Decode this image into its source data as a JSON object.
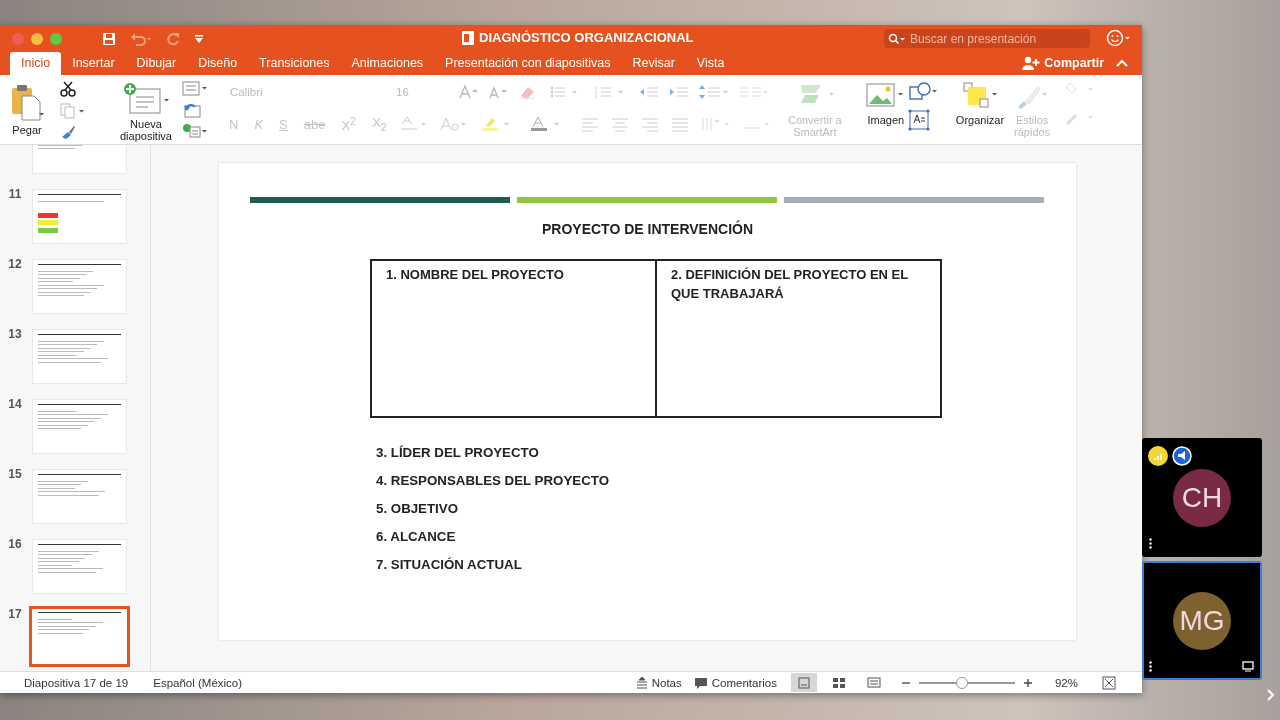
{
  "window": {
    "title": "DIAGNÓSTICO ORGANIZACIONAL",
    "search": {
      "placeholder": "Buscar en presentación"
    }
  },
  "ribbon_tabs": [
    {
      "label": "Inicio",
      "selected": true
    },
    {
      "label": "Insertar",
      "selected": false
    },
    {
      "label": "Dibujar",
      "selected": false
    },
    {
      "label": "Diseño",
      "selected": false
    },
    {
      "label": "Transiciones",
      "selected": false
    },
    {
      "label": "Animaciones",
      "selected": false
    },
    {
      "label": "Presentación con diapositivas",
      "selected": false
    },
    {
      "label": "Revisar",
      "selected": false
    },
    {
      "label": "Vista",
      "selected": false
    }
  ],
  "share_button": "Compartir",
  "ribbon": {
    "paste": "Pegar",
    "new_slide": "Nueva diapositiva",
    "font": {
      "value": "Calibri",
      "disabled": true
    },
    "size": {
      "value": "16",
      "disabled": true
    },
    "format_buttons": [
      {
        "label": "N",
        "disabled": true
      },
      {
        "label": "K",
        "disabled": true
      },
      {
        "label": "S",
        "disabled": true
      },
      {
        "label": "abe",
        "disabled": true
      },
      {
        "label": "X$^{2}$",
        "disabled": true
      },
      {
        "label": "X$_{2}$",
        "disabled": true
      }
    ],
    "smartart": {
      "label": "Convertir a SmartArt",
      "disabled": true
    },
    "picture": {
      "label": "Imagen",
      "disabled": false
    },
    "arrange": {
      "label": "Organizar",
      "disabled": false
    },
    "quick_styles": {
      "label": "Estilos rápidos",
      "disabled": true
    }
  },
  "thumbnails": [
    {
      "selected": false
    },
    {
      "number": "11",
      "selected": false
    },
    {
      "number": "12",
      "selected": false
    },
    {
      "number": "13",
      "selected": false
    },
    {
      "number": "14",
      "selected": false
    },
    {
      "number": "15",
      "selected": false
    },
    {
      "number": "16",
      "selected": false
    },
    {
      "number": "17",
      "selected": true
    }
  ],
  "slide": {
    "bars": [
      {
        "color": "#1e5b4f"
      },
      {
        "color": "#8dc63f"
      },
      {
        "color": "#a3b1ba"
      }
    ],
    "title": "PROYECTO DE INTERVENCIÓN",
    "table_headers": [
      "1. NOMBRE DEL PROYECTO",
      "2. DEFINICIÓN DEL PROYECTO EN EL QUE TRABAJARÁ"
    ],
    "items": [
      "3. LÍDER DEL PROYECTO",
      "4. RESPONSABLES DEL PROYECTO",
      "5. OBJETIVO",
      "6. ALCANCE",
      "7. SITUACIÓN ACTUAL"
    ]
  },
  "status_bar": {
    "slide_position": "Diapositiva 17 de 19",
    "language": "Español (México)",
    "notes": "Notas",
    "comments": "Comentarios",
    "views": [
      {
        "selected": true
      },
      {
        "selected": false
      },
      {
        "selected": false
      }
    ],
    "zoom": {
      "level": 0.45,
      "reading": "92%"
    }
  },
  "participants": [
    {
      "initials": "CH",
      "color": "#7a2a45",
      "selected": false
    },
    {
      "initials": "MG",
      "color": "#7d6230",
      "selected": true
    }
  ]
}
